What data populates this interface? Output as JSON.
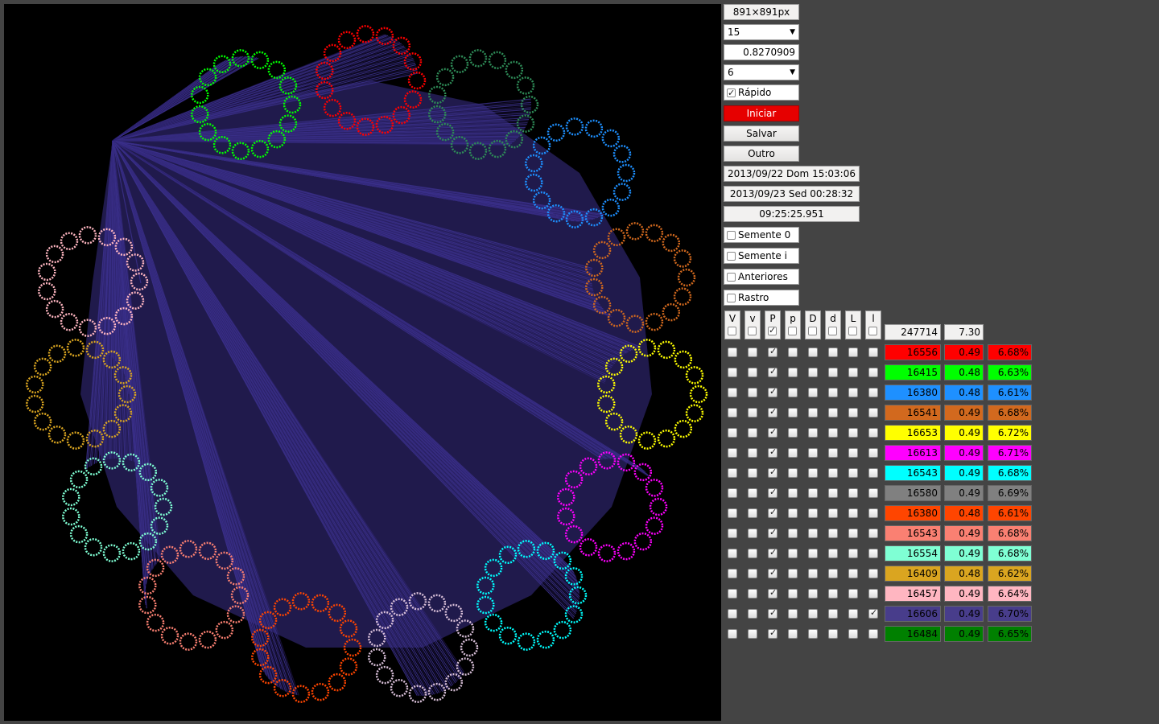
{
  "canvas": {
    "background": "#000000",
    "fan_color": "#3a2f8a"
  },
  "controls": {
    "size_display": "891×891px",
    "select_a": "15",
    "ratio_value": "0.8270909",
    "select_b": "6",
    "fast_label": "Rápido",
    "fast_checked": true,
    "start_label": "Iniciar",
    "save_label": "Salvar",
    "other_label": "Outro",
    "start_time": "2013/09/22 Dom 15:03:06",
    "end_time": "2013/09/23 Sed 00:28:32",
    "elapsed": "09:25:25.951",
    "seed0_label": "Semente 0",
    "seedi_label": "Semente i",
    "previous_label": "Anteriores",
    "trail_label": "Rastro"
  },
  "table": {
    "column_headers": [
      "V",
      "v",
      "P",
      "p",
      "D",
      "d",
      "L",
      "l"
    ],
    "header_checks": [
      false,
      false,
      true,
      false,
      false,
      false,
      false,
      false
    ],
    "total_count": "247714",
    "total_value": "7.30",
    "rows": [
      {
        "color": "#ff0000",
        "text": "#000000",
        "count": "16556",
        "ratio": "0.49",
        "pct": "6.68%",
        "checks": [
          false,
          false,
          true,
          false,
          false,
          false,
          false,
          false
        ]
      },
      {
        "color": "#00ff00",
        "text": "#000000",
        "count": "16415",
        "ratio": "0.48",
        "pct": "6.63%",
        "checks": [
          false,
          false,
          true,
          false,
          false,
          false,
          false,
          false
        ]
      },
      {
        "color": "#1e90ff",
        "text": "#000000",
        "count": "16380",
        "ratio": "0.48",
        "pct": "6.61%",
        "checks": [
          false,
          false,
          true,
          false,
          false,
          false,
          false,
          false
        ]
      },
      {
        "color": "#d2691e",
        "text": "#000000",
        "count": "16541",
        "ratio": "0.49",
        "pct": "6.68%",
        "checks": [
          false,
          false,
          true,
          false,
          false,
          false,
          false,
          false
        ]
      },
      {
        "color": "#ffff00",
        "text": "#000000",
        "count": "16653",
        "ratio": "0.49",
        "pct": "6.72%",
        "checks": [
          false,
          false,
          true,
          false,
          false,
          false,
          false,
          false
        ]
      },
      {
        "color": "#ff00ff",
        "text": "#000000",
        "count": "16613",
        "ratio": "0.49",
        "pct": "6.71%",
        "checks": [
          false,
          false,
          true,
          false,
          false,
          false,
          false,
          false
        ]
      },
      {
        "color": "#00ffff",
        "text": "#000000",
        "count": "16543",
        "ratio": "0.49",
        "pct": "6.68%",
        "checks": [
          false,
          false,
          true,
          false,
          false,
          false,
          false,
          false
        ]
      },
      {
        "color": "#808080",
        "text": "#000000",
        "count": "16580",
        "ratio": "0.49",
        "pct": "6.69%",
        "checks": [
          false,
          false,
          true,
          false,
          false,
          false,
          false,
          false
        ]
      },
      {
        "color": "#ff4500",
        "text": "#000000",
        "count": "16380",
        "ratio": "0.48",
        "pct": "6.61%",
        "checks": [
          false,
          false,
          true,
          false,
          false,
          false,
          false,
          false
        ]
      },
      {
        "color": "#fa8072",
        "text": "#000000",
        "count": "16543",
        "ratio": "0.49",
        "pct": "6.68%",
        "checks": [
          false,
          false,
          true,
          false,
          false,
          false,
          false,
          false
        ]
      },
      {
        "color": "#7fffd4",
        "text": "#000000",
        "count": "16554",
        "ratio": "0.49",
        "pct": "6.68%",
        "checks": [
          false,
          false,
          true,
          false,
          false,
          false,
          false,
          false
        ]
      },
      {
        "color": "#daa520",
        "text": "#000000",
        "count": "16409",
        "ratio": "0.48",
        "pct": "6.62%",
        "checks": [
          false,
          false,
          true,
          false,
          false,
          false,
          false,
          false
        ]
      },
      {
        "color": "#ffb6c1",
        "text": "#000000",
        "count": "16457",
        "ratio": "0.49",
        "pct": "6.64%",
        "checks": [
          false,
          false,
          true,
          false,
          false,
          false,
          false,
          false
        ]
      },
      {
        "color": "#483d8b",
        "text": "#000000",
        "count": "16606",
        "ratio": "0.49",
        "pct": "6.70%",
        "checks": [
          false,
          false,
          true,
          false,
          false,
          false,
          false,
          true
        ]
      },
      {
        "color": "#008000",
        "text": "#000000",
        "count": "16484",
        "ratio": "0.49",
        "pct": "6.65%",
        "checks": [
          false,
          false,
          true,
          false,
          false,
          false,
          false,
          false
        ]
      }
    ]
  }
}
